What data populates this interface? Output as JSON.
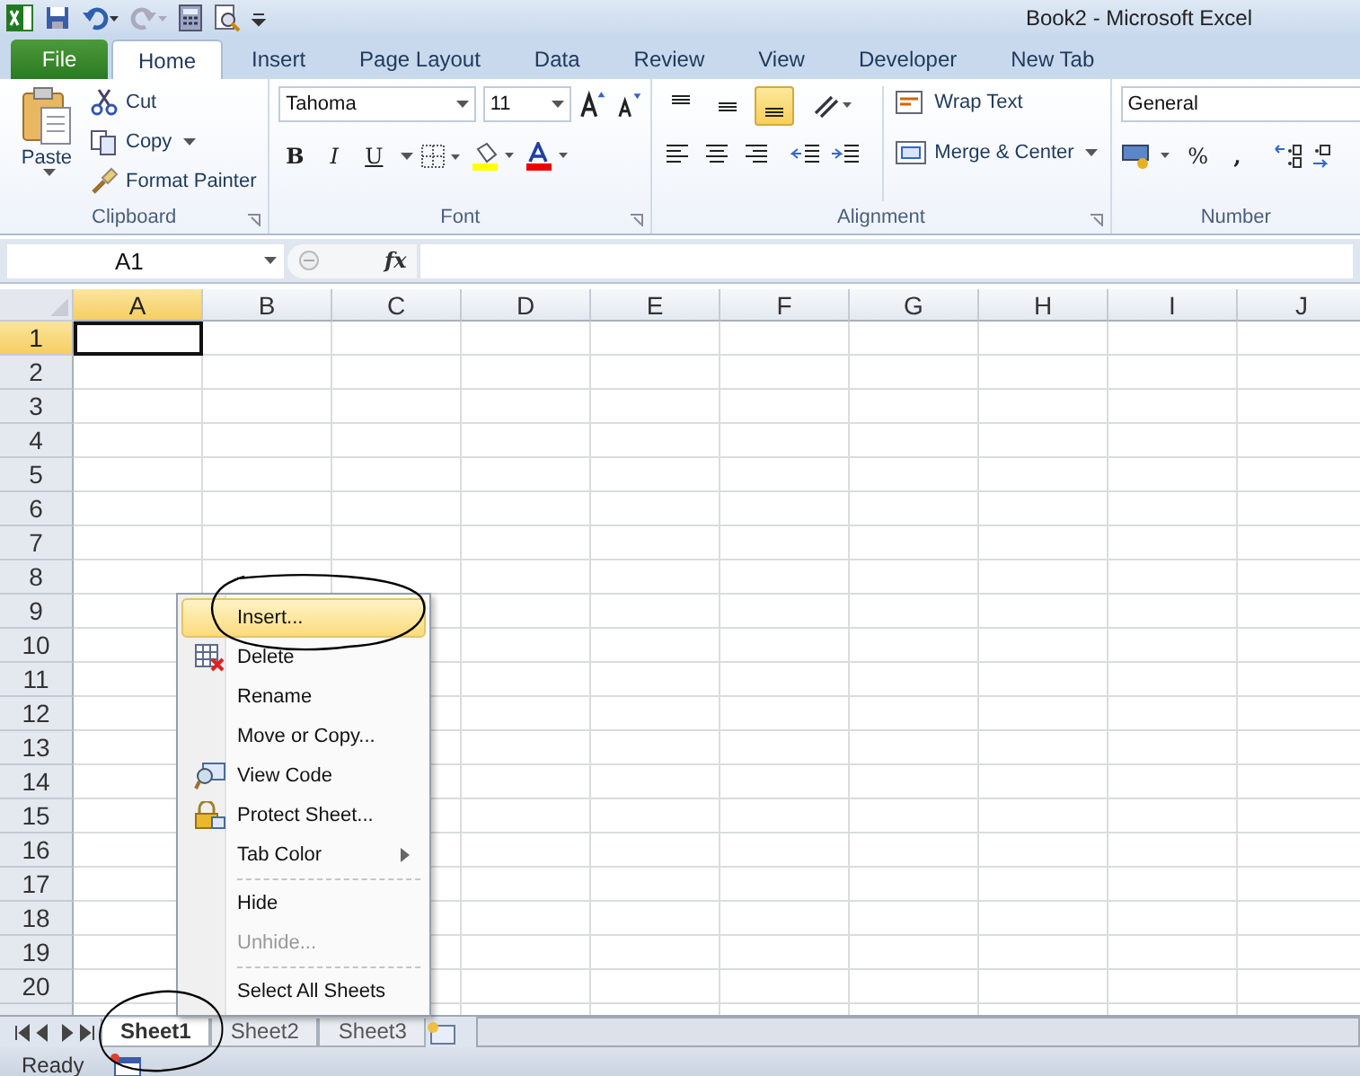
{
  "window": {
    "title": "Book2  -  Microsoft Excel"
  },
  "ribbon_tabs": [
    {
      "label": "File",
      "kind": "file",
      "selected": false
    },
    {
      "label": "Home",
      "kind": "tab",
      "selected": true
    },
    {
      "label": "Insert",
      "kind": "tab",
      "selected": false
    },
    {
      "label": "Page Layout",
      "kind": "tab",
      "selected": false
    },
    {
      "label": "Data",
      "kind": "tab",
      "selected": false
    },
    {
      "label": "Review",
      "kind": "tab",
      "selected": false
    },
    {
      "label": "View",
      "kind": "tab",
      "selected": false
    },
    {
      "label": "Developer",
      "kind": "tab",
      "selected": false
    },
    {
      "label": "New Tab",
      "kind": "tab",
      "selected": false
    }
  ],
  "clipboard": {
    "title": "Clipboard",
    "paste": "Paste",
    "cut": "Cut",
    "copy": "Copy",
    "format_painter": "Format Painter"
  },
  "font": {
    "title": "Font",
    "font_name": "Tahoma",
    "font_size": "11",
    "bold": "B",
    "italic": "I",
    "underline": "U"
  },
  "alignment": {
    "title": "Alignment",
    "vertical": [
      {
        "selected": false
      },
      {
        "selected": false
      },
      {
        "selected": true
      }
    ],
    "wrap_text": "Wrap Text",
    "merge_center": "Merge & Center"
  },
  "number": {
    "title": "Number",
    "format": "General",
    "percent": "%",
    "comma": ","
  },
  "formula_bar": {
    "name_box": "A1",
    "fx": "fx"
  },
  "grid": {
    "columns": [
      {
        "label": "A",
        "selected": true
      },
      {
        "label": "B",
        "selected": false
      },
      {
        "label": "C",
        "selected": false
      },
      {
        "label": "D",
        "selected": false
      },
      {
        "label": "E",
        "selected": false
      },
      {
        "label": "F",
        "selected": false
      },
      {
        "label": "G",
        "selected": false
      },
      {
        "label": "H",
        "selected": false
      },
      {
        "label": "I",
        "selected": false
      },
      {
        "label": "J",
        "selected": false
      }
    ],
    "rows": [
      {
        "label": "1",
        "selected": true
      },
      {
        "label": "2",
        "selected": false
      },
      {
        "label": "3",
        "selected": false
      },
      {
        "label": "4",
        "selected": false
      },
      {
        "label": "5",
        "selected": false
      },
      {
        "label": "6",
        "selected": false
      },
      {
        "label": "7",
        "selected": false
      },
      {
        "label": "8",
        "selected": false
      },
      {
        "label": "9",
        "selected": false
      },
      {
        "label": "10",
        "selected": false
      },
      {
        "label": "11",
        "selected": false
      },
      {
        "label": "12",
        "selected": false
      },
      {
        "label": "13",
        "selected": false
      },
      {
        "label": "14",
        "selected": false
      },
      {
        "label": "15",
        "selected": false
      },
      {
        "label": "16",
        "selected": false
      },
      {
        "label": "17",
        "selected": false
      },
      {
        "label": "18",
        "selected": false
      },
      {
        "label": "19",
        "selected": false
      },
      {
        "label": "20",
        "selected": false
      }
    ]
  },
  "context_menu": [
    {
      "label": "Insert...",
      "kind": "plain",
      "selected": true,
      "disabled": false,
      "submenu": false,
      "separator_before": false
    },
    {
      "label": "Delete",
      "kind": "delete",
      "selected": false,
      "disabled": false,
      "submenu": false,
      "separator_before": false
    },
    {
      "label": "Rename",
      "kind": "plain",
      "selected": false,
      "disabled": false,
      "submenu": false,
      "separator_before": false
    },
    {
      "label": "Move or Copy...",
      "kind": "plain",
      "selected": false,
      "disabled": false,
      "submenu": false,
      "separator_before": false
    },
    {
      "label": "View Code",
      "kind": "code",
      "selected": false,
      "disabled": false,
      "submenu": false,
      "separator_before": false
    },
    {
      "label": "Protect Sheet...",
      "kind": "lock",
      "selected": false,
      "disabled": false,
      "submenu": false,
      "separator_before": false
    },
    {
      "label": "Tab Color",
      "kind": "plain",
      "selected": false,
      "disabled": false,
      "submenu": true,
      "separator_before": false
    },
    {
      "label": "Hide",
      "kind": "plain",
      "selected": false,
      "disabled": false,
      "submenu": false,
      "separator_before": true
    },
    {
      "label": "Unhide...",
      "kind": "plain",
      "selected": false,
      "disabled": true,
      "submenu": false,
      "separator_before": false
    },
    {
      "label": "Select All Sheets",
      "kind": "plain",
      "selected": false,
      "disabled": false,
      "submenu": false,
      "separator_before": true
    }
  ],
  "sheet_tabs": [
    {
      "label": "Sheet1",
      "selected": true
    },
    {
      "label": "Sheet2",
      "selected": false
    },
    {
      "label": "Sheet3",
      "selected": false
    }
  ],
  "status_bar": {
    "text": "Ready"
  }
}
